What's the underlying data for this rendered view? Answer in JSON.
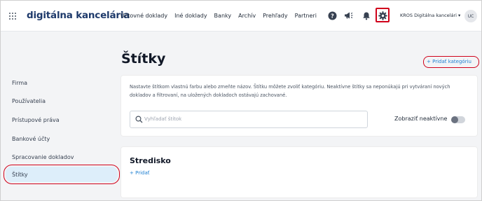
{
  "header": {
    "logo": "digitálna kancelária",
    "nav": [
      "Účtovné doklady",
      "Iné doklady",
      "Banky",
      "Archív",
      "Prehľady",
      "Partneri"
    ],
    "company": "KROS Digitálna kancelári ▾",
    "avatar_initials": "UC",
    "icons": [
      "help-icon",
      "announcement-icon",
      "bell-icon",
      "gear-icon"
    ]
  },
  "sidebar": {
    "items": [
      {
        "label": "Firma"
      },
      {
        "label": "Používatelia"
      },
      {
        "label": "Prístupové práva"
      },
      {
        "label": "Bankové účty"
      },
      {
        "label": "Spracovanie dokladov"
      },
      {
        "label": "Štítky",
        "active": true
      }
    ]
  },
  "main": {
    "title": "Štítky",
    "add_category": "+ Pridať kategóriu",
    "description": "Nastavte štítkom vlastnú farbu alebo zmeňte názov. Štítku môžete zvoliť kategóriu. Neaktívne štítky sa neponúkajú pri vytváraní nových dokladov a filtrovaní, na uložených dokladoch ostávajú zachované.",
    "search_placeholder": "Vyhľadať štítok",
    "toggle_label": "Zobraziť neaktívne",
    "toggle_on": false,
    "section": {
      "title": "Stredisko",
      "add_label": "+ Pridať"
    }
  },
  "colors": {
    "brand": "#1e3a6b",
    "link": "#1d7fd1",
    "highlight": "#d0021b",
    "active_bg": "#ddeefa"
  }
}
